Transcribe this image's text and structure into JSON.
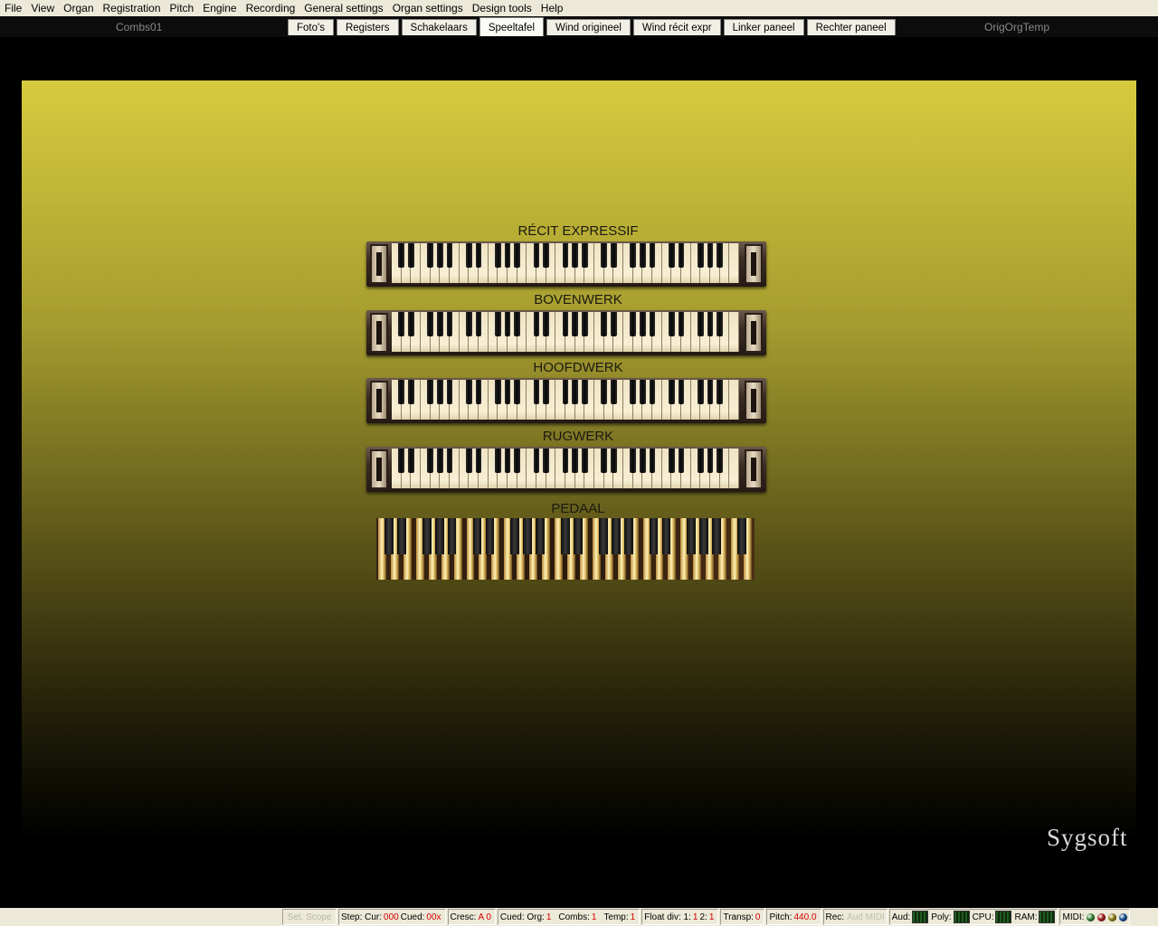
{
  "menubar": {
    "items": [
      "File",
      "View",
      "Organ",
      "Registration",
      "Pitch",
      "Engine",
      "Recording",
      "General settings",
      "Organ settings",
      "Design tools",
      "Help"
    ]
  },
  "tabbar": {
    "left_label": "Combs01",
    "right_label": "OrigOrgTemp",
    "tabs": [
      "Foto's",
      "Registers",
      "Schakelaars",
      "Speeltafel",
      "Wind origineel",
      "Wind récit expr",
      "Linker paneel",
      "Rechter paneel"
    ],
    "active_tab": "Speeltafel"
  },
  "console": {
    "manuals": [
      "RÉCIT EXPRESSIF",
      "BOVENWERK",
      "HOOFDWERK",
      "RUGWERK"
    ],
    "pedal_label": "PEDAAL",
    "logo": "Sygsoft"
  },
  "statusbar": {
    "set_scope": "Set. Scope",
    "step_label": "Step: Cur:",
    "step_cur": "000",
    "step_cued_label": "Cued:",
    "step_cued": "00x",
    "cresc_label": "Cresc:",
    "cresc_value": "A 0",
    "cued_org_label": "Cued: Org:",
    "cued_org": "1",
    "combs_label": "Combs:",
    "combs": "1",
    "temp_label": "Temp:",
    "temp": "1",
    "float_label": "Float div: 1:",
    "float_a": "1",
    "float_mid": "2:",
    "float_b": "1",
    "transp_label": "Transp:",
    "transp": "0",
    "pitch_label": "Pitch:",
    "pitch": "440.0",
    "rec_label": "Rec:",
    "rec_value": "Aud MIDI",
    "aud_label": "Aud:",
    "poly_label": "Poly:",
    "cpu_label": "CPU:",
    "ram_label": "RAM:",
    "midi_label": "MIDI:",
    "led_colors": [
      "#2f7d2f",
      "#a01818",
      "#8a7a10",
      "#104a8a"
    ]
  },
  "colors": {
    "background_top": "#d6cb3e",
    "background_bottom": "#000000",
    "accent_red": "#d40000"
  }
}
